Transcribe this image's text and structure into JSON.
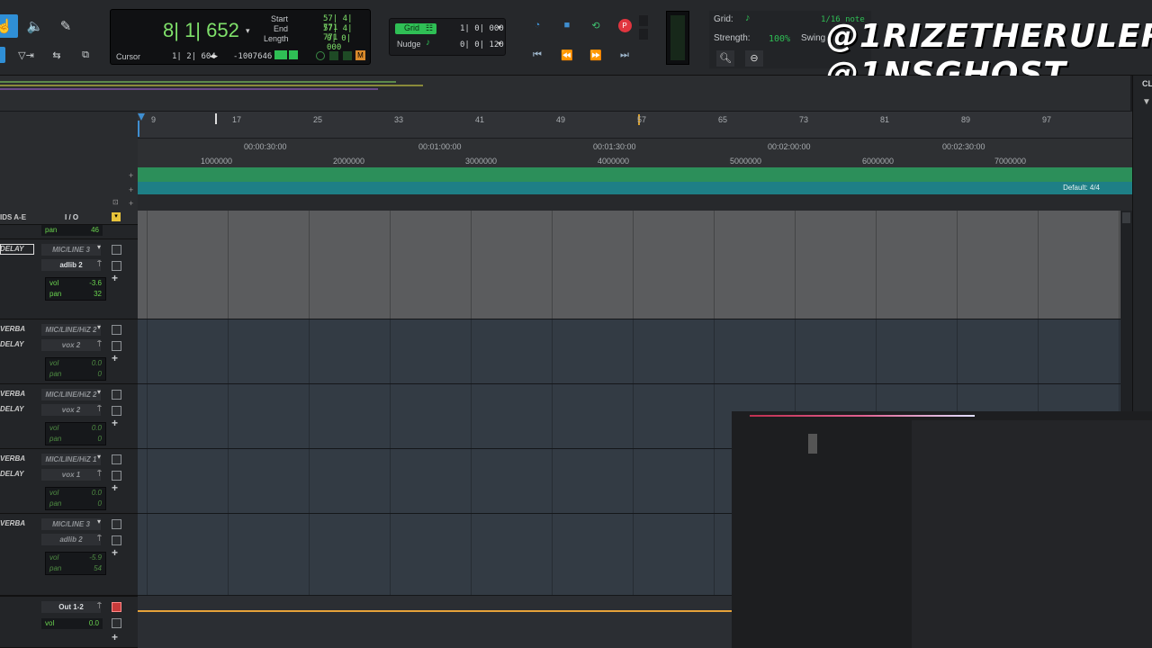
{
  "toolbar": {
    "tools": [
      {
        "name": "grabber-tool-icon",
        "glyph": "☝"
      },
      {
        "name": "speaker-icon",
        "glyph": "🔊"
      },
      {
        "name": "pencil-icon",
        "glyph": "✎"
      }
    ],
    "counter": {
      "main": "8| 1| 652",
      "cursor_label": "Cursor",
      "cursor_value": "1| 2| 604",
      "cursor_sample": "-1007646",
      "start_label": "Start",
      "end_label": "End",
      "length_label": "Length",
      "start_value": "57| 4| 771",
      "end_value": "57| 4| 771",
      "length_value": "0| 0| 000"
    },
    "grid_nudge": {
      "grid_label": "Grid",
      "grid_value": "1| 0| 000",
      "nudge_label": "Nudge",
      "nudge_value": "0| 0| 120"
    },
    "grid_panel": {
      "grid_label": "Grid:",
      "grid_value": "1/16 note",
      "strength_label": "Strength:",
      "strength_value": "100%",
      "swing_label": "Swing"
    },
    "handles": [
      "@1RIZETHERULER",
      "@1NSGHOST"
    ]
  },
  "ruler": {
    "bars": [
      "9",
      "17",
      "25",
      "33",
      "41",
      "49",
      "57",
      "65",
      "73",
      "81",
      "89",
      "97"
    ],
    "times": [
      "00:00:30:00",
      "00:01:00:00",
      "00:01:30:00",
      "00:02:00:00",
      "00:02:30:00"
    ],
    "samples": [
      "1000000",
      "2000000",
      "3000000",
      "4000000",
      "5000000",
      "6000000",
      "7000000"
    ],
    "meter_default": "Default: 4/4"
  },
  "tracks_header": {
    "inserts_label": "IDS A-E",
    "io_label": "I / O",
    "top_pan_label": "pan",
    "top_pan_value": "46"
  },
  "tracks": [
    {
      "insert1": "DELAY",
      "insert2": "",
      "input": "MIC/LINE 3",
      "output": "adlib 2",
      "vol": "-3.6",
      "pan": "32",
      "active": true
    },
    {
      "insert1": "VERBA",
      "insert2": "DELAY",
      "input": "MIC/LINE/HiZ 2",
      "output": "vox 2",
      "vol": "0.0",
      "pan": "0",
      "active": false
    },
    {
      "insert1": "VERBA",
      "insert2": "DELAY",
      "input": "MIC/LINE/HiZ 2",
      "output": "vox 2",
      "vol": "0.0",
      "pan": "0",
      "active": false
    },
    {
      "insert1": "VERBA",
      "insert2": "DELAY",
      "input": "MIC/LINE/HiZ 1",
      "output": "vox 1",
      "vol": "0.0",
      "pan": "0",
      "active": false
    },
    {
      "insert1": "VERBA",
      "insert2": "",
      "input": "MIC/LINE 3",
      "output": "adlib 2",
      "vol": "-5.9",
      "pan": "54",
      "active": false
    }
  ],
  "master": {
    "output": "Out 1-2",
    "vol_label": "vol",
    "vol": "0.0"
  },
  "side_panel": {
    "label": "CL"
  },
  "colors": {
    "accent_green": "#7fe06a",
    "tempo_green": "#2c8f5a",
    "meter_teal": "#1e7f86",
    "lane_blue": "#333b44",
    "lane_gray": "#5b5c5e"
  }
}
